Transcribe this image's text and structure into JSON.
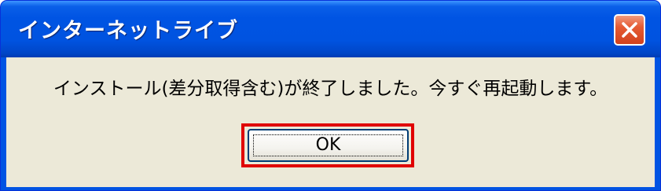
{
  "window": {
    "title": "インターネットライブ",
    "close_icon": "close-icon"
  },
  "dialog": {
    "message": "インストール(差分取得含む)が終了しました。今すぐ再起動します。",
    "ok_label": "OK"
  },
  "colors": {
    "titlebar": "#0054e3",
    "client_background": "#ece9d8",
    "close_button": "#e55b33",
    "highlight_border": "#e00000"
  }
}
